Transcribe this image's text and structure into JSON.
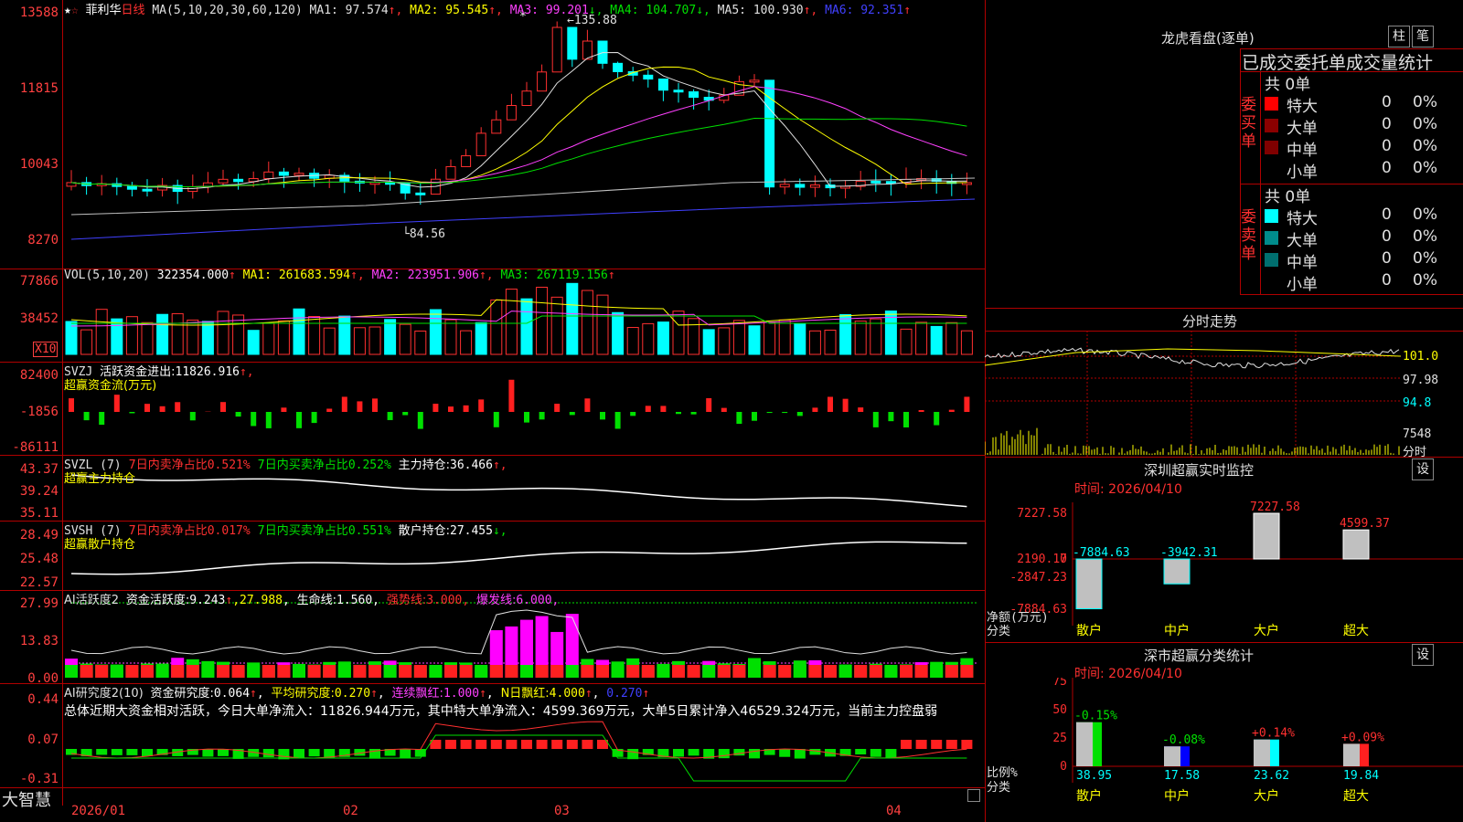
{
  "stock": {
    "star": "★",
    "star2": "☆",
    "name": "菲利华",
    "period": "日线"
  },
  "price_axis": [
    "13588",
    "11815",
    "10043",
    "8270"
  ],
  "ma_header": {
    "label": "MA(5,10,20,30,60,120)",
    "items": [
      {
        "name": "MA1:",
        "value": "97.574",
        "arrow": "↑",
        "color": "#e0e0e0"
      },
      {
        "name": "MA2:",
        "value": "95.545",
        "arrow": "↑",
        "color": "#ffff00"
      },
      {
        "name": "MA3:",
        "value": "99.201",
        "arrow": "↓",
        "color": "#ff40ff"
      },
      {
        "name": "MA4:",
        "value": "104.707",
        "arrow": "↓",
        "color": "#00e000"
      },
      {
        "name": "MA5:",
        "value": "100.930",
        "arrow": "↑",
        "color": "#e0e0e0"
      },
      {
        "name": "MA6:",
        "value": "92.351",
        "arrow": "↑",
        "color": "#4040ff"
      }
    ]
  },
  "price_marks": {
    "high": "135.88",
    "low": "84.56",
    "high_star": "*"
  },
  "vol_header": {
    "label": "VOL(5,10,20)",
    "value": "322354.000",
    "arrow": "↑",
    "items": [
      {
        "name": "MA1:",
        "value": "261683.594",
        "arrow": "↑",
        "color": "#ffff00"
      },
      {
        "name": "MA2:",
        "value": "223951.906",
        "arrow": "↑",
        "color": "#ff40ff"
      },
      {
        "name": "MA3:",
        "value": "267119.156",
        "arrow": "↑",
        "color": "#00e000"
      }
    ]
  },
  "vol_axis": [
    "77866",
    "38452"
  ],
  "vol_unit": "X10",
  "svzj": {
    "label": "SVZJ",
    "text1": "活跃资金进出:",
    "value": "11826.916",
    "arrow": "↑,",
    "sub": "超赢资金流(万元)",
    "axis": [
      "82400",
      "-1856",
      "-86111"
    ]
  },
  "svzl": {
    "label": "SVZL (7)",
    "t1": "7日内卖净占比",
    "v1": "0.521%",
    "t2": "7日内买卖净占比",
    "v2": "0.252%",
    "t3": "主力持仓:",
    "v3": "36.466",
    "arrow": "↑,",
    "sub": "超赢主力持仓",
    "axis": [
      "43.37",
      "39.24",
      "35.11"
    ]
  },
  "svsh": {
    "label": "SVSH (7)",
    "t1": "7日内卖净占比",
    "v1": "0.017%",
    "t2": "7日内买卖净占比",
    "v2": "0.551%",
    "t3": "散户持仓:",
    "v3": "27.455",
    "arrow": "↓,",
    "sub": "超赢散户持仓",
    "axis": [
      "28.49",
      "25.48",
      "22.57"
    ]
  },
  "ai1": {
    "label": "AI活跃度2",
    "t1": "资金活跃度:",
    "v1": "9.243",
    "a1": "↑",
    "v2": "27.988",
    "t3": "生命线:",
    "v3": "1.560",
    "t4": "强势线:",
    "v4": "3.000",
    "t5": "爆发线:",
    "v5": "6.000",
    "axis": [
      "27.99",
      "13.83",
      "0.00"
    ]
  },
  "ai2": {
    "label": "AI研究度2(10)",
    "t1": "资金研究度:",
    "v1": "0.064",
    "a1": "↑",
    "t2": "平均研究度:",
    "v2": "0.270",
    "a2": "↑",
    "t3": "连续飘红:",
    "v3": "1.000",
    "a3": "↑",
    "t4": "N日飘红:",
    "v4": "4.000",
    "a4": "↑",
    "v5": "0.270",
    "a5": "↑",
    "summary": "总体近期大资金相对活跃，今日大单净流入：11826.944万元，其中特大单净流入：4599.369万元，大单5日累计净入46529.324万元，当前主力控盘弱",
    "axis": [
      "0.44",
      "0.07",
      "-0.31"
    ]
  },
  "dates": [
    "2026/01",
    "02",
    "03",
    "04"
  ],
  "brand": "大智慧",
  "right_panel": {
    "title": "龙虎看盘(逐单)",
    "btn_zhu": "柱",
    "btn_bi": "笔",
    "subtitle": "已成交委托单成交量统计",
    "buy": {
      "side_label": "委买单",
      "total": "共 0单",
      "rows": [
        {
          "name": "特大",
          "count": "0",
          "pct": "0%",
          "color": "#ff0000"
        },
        {
          "name": "大单",
          "count": "0",
          "pct": "0%",
          "color": "#8b0000"
        },
        {
          "name": "中单",
          "count": "0",
          "pct": "0%",
          "color": "#800000"
        },
        {
          "name": "小单",
          "count": "0",
          "pct": "0%",
          "color": ""
        }
      ]
    },
    "sell": {
      "side_label": "委卖单",
      "total": "共 0单",
      "rows": [
        {
          "name": "特大",
          "count": "0",
          "pct": "0%",
          "color": "#00ffff"
        },
        {
          "name": "大单",
          "count": "0",
          "pct": "0%",
          "color": "#008b8b"
        },
        {
          "name": "中单",
          "count": "0",
          "pct": "0%",
          "color": "#006f6f"
        },
        {
          "name": "小单",
          "count": "0",
          "pct": "0%",
          "color": ""
        }
      ]
    },
    "intraday": {
      "title": "分时走势",
      "axis": [
        "101.0",
        "97.98",
        "94.8"
      ],
      "vol_axis": "7548",
      "unit": "分时"
    },
    "sz_monitor": {
      "title": "深圳超赢实时监控",
      "btn": "设",
      "time": "时间: 2026/04/10",
      "axis": [
        "7227.58",
        "2190.17",
        "0",
        "-2847.23",
        "-7884.63"
      ],
      "ylabel": "净额(万元)",
      "xlabel": "分类",
      "values": [
        "-7884.63",
        "-3942.31",
        "7227.58",
        "4599.37"
      ],
      "cats": [
        "散户",
        "中户",
        "大户",
        "超大"
      ]
    },
    "sz_class": {
      "title": "深市超赢分类统计",
      "btn": "设",
      "time": "时间: 2026/04/10",
      "axis": [
        "75",
        "50",
        "25",
        "0"
      ],
      "ylabel": "比例%",
      "xlabel": "分类",
      "deltas": [
        "-0.15%",
        "-0.08%",
        "+0.14%",
        "+0.09%"
      ],
      "values": [
        "38.95",
        "17.58",
        "23.62",
        "19.84"
      ],
      "cats": [
        "散户",
        "中户",
        "大户",
        "超大"
      ]
    }
  },
  "colors": {
    "up": "#ff3030",
    "down": "#00ffff",
    "grid": "#b00000",
    "axis_text": "#ff4040"
  }
}
